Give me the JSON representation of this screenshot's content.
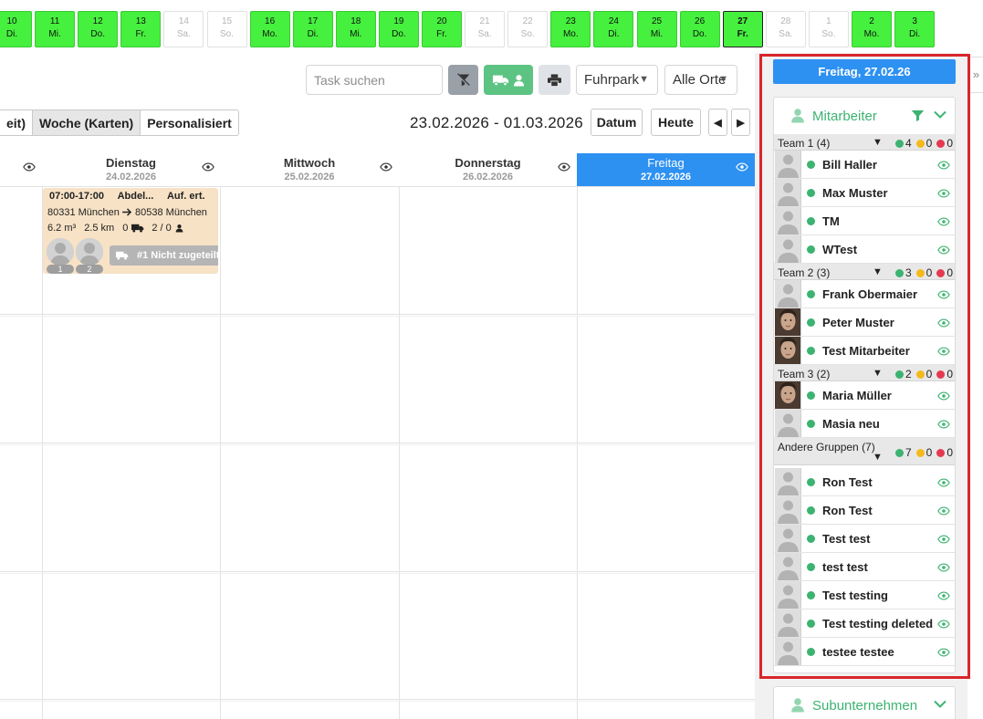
{
  "days": [
    {
      "num": "10",
      "wd": "Di.",
      "state": "green"
    },
    {
      "num": "11",
      "wd": "Mi.",
      "state": "green"
    },
    {
      "num": "12",
      "wd": "Do.",
      "state": "green"
    },
    {
      "num": "13",
      "wd": "Fr.",
      "state": "green"
    },
    {
      "num": "14",
      "wd": "Sa.",
      "state": "gray"
    },
    {
      "num": "15",
      "wd": "So.",
      "state": "gray"
    },
    {
      "num": "16",
      "wd": "Mo.",
      "state": "green"
    },
    {
      "num": "17",
      "wd": "Di.",
      "state": "green"
    },
    {
      "num": "18",
      "wd": "Mi.",
      "state": "green"
    },
    {
      "num": "19",
      "wd": "Do.",
      "state": "green"
    },
    {
      "num": "20",
      "wd": "Fr.",
      "state": "green"
    },
    {
      "num": "21",
      "wd": "Sa.",
      "state": "gray"
    },
    {
      "num": "22",
      "wd": "So.",
      "state": "gray"
    },
    {
      "num": "23",
      "wd": "Mo.",
      "state": "green"
    },
    {
      "num": "24",
      "wd": "Di.",
      "state": "green"
    },
    {
      "num": "25",
      "wd": "Mi.",
      "state": "green"
    },
    {
      "num": "26",
      "wd": "Do.",
      "state": "green"
    },
    {
      "num": "27",
      "wd": "Fr.",
      "state": "green active"
    },
    {
      "num": "28",
      "wd": "Sa.",
      "state": "gray"
    },
    {
      "num": "1",
      "wd": "So.",
      "state": "gray"
    },
    {
      "num": "2",
      "wd": "Mo.",
      "state": "green"
    },
    {
      "num": "3",
      "wd": "Di.",
      "state": "green"
    }
  ],
  "toolbar": {
    "search_placeholder": "Task suchen",
    "fleet_select": "Fuhrpark",
    "place_select": "Alle Orte"
  },
  "view_tabs": [
    "eit)",
    "Woche (Karten)",
    "Personalisiert"
  ],
  "date_range": "23.02.2026 - 01.03.2026",
  "nav": {
    "datum": "Datum",
    "heute": "Heute",
    "prev": "◀",
    "next": "▶"
  },
  "columns": [
    {
      "name": "Dienstag",
      "date": "24.02.2026"
    },
    {
      "name": "Mittwoch",
      "date": "25.02.2026"
    },
    {
      "name": "Donnerstag",
      "date": "26.02.2026"
    },
    {
      "name": "Freitag",
      "date": "27.02.2026"
    }
  ],
  "task": {
    "time": "07:00-17:00",
    "customer": "Abdel...",
    "type": "Auf. ert.",
    "from": "80331 München",
    "to": "80538 München",
    "volume": "6.2 m³",
    "distance": "2.5 km",
    "vehicles": "0",
    "staff": "2 / 0",
    "avatar_1": "1",
    "avatar_2": "2",
    "vehicle_chip": "#1 Nicht zugeteilt"
  },
  "sidebar": {
    "date_chip": "Freitag, 27.02.26",
    "panel_title": "Mitarbeiter",
    "sub_panel_title": "Subunternehmen",
    "groups": [
      {
        "name": "Team 1 (4)",
        "green": "4",
        "yellow": "0",
        "red": "0",
        "members": [
          {
            "name": "Bill Haller",
            "photo": false
          },
          {
            "name": "Max Muster",
            "photo": false
          },
          {
            "name": "TM",
            "photo": false
          },
          {
            "name": "WTest",
            "photo": false
          }
        ]
      },
      {
        "name": "Team 2 (3)",
        "green": "3",
        "yellow": "0",
        "red": "0",
        "members": [
          {
            "name": "Frank Obermaier",
            "photo": false
          },
          {
            "name": "Peter Muster",
            "photo": true
          },
          {
            "name": "Test Mitarbeiter",
            "photo": true
          }
        ]
      },
      {
        "name": "Team 3 (2)",
        "green": "2",
        "yellow": "0",
        "red": "0",
        "members": [
          {
            "name": "Maria Müller",
            "photo": true
          },
          {
            "name": "Masia neu",
            "photo": false
          }
        ]
      },
      {
        "name": "Andere Gruppen (7)",
        "green": "7",
        "yellow": "0",
        "red": "0",
        "members": [
          {
            "name": "Ron Test",
            "photo": false
          },
          {
            "name": "Ron Test",
            "photo": false
          },
          {
            "name": "Test test",
            "photo": false
          },
          {
            "name": "test test",
            "photo": false
          },
          {
            "name": "Test testing",
            "photo": false
          },
          {
            "name": "Test testing deleted",
            "photo": false
          },
          {
            "name": "testee testee",
            "photo": false
          }
        ]
      }
    ]
  },
  "colors": {
    "day_green": "#46f03e",
    "today_blue": "#2d91f2",
    "accent_green": "#3cb371",
    "highlight_red": "#d9262a",
    "card_bg": "#f7e2c6"
  }
}
